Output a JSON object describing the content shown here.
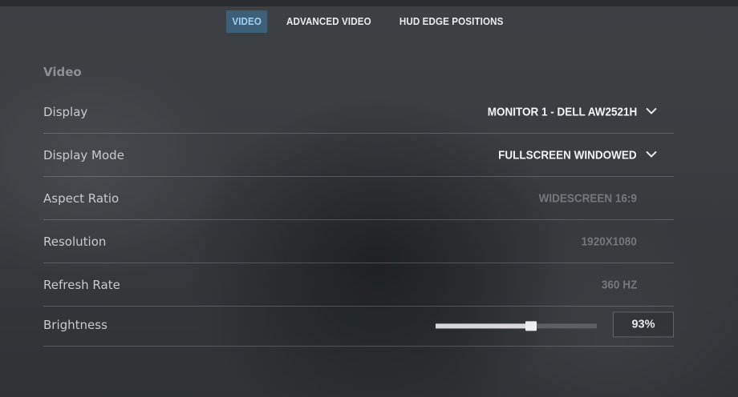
{
  "tabs": [
    {
      "label": "VIDEO",
      "active": true
    },
    {
      "label": "ADVANCED VIDEO",
      "active": false
    },
    {
      "label": "HUD EDGE POSITIONS",
      "active": false
    }
  ],
  "section": {
    "title": "Video"
  },
  "settings": {
    "display": {
      "label": "Display",
      "value": "MONITOR 1 - DELL AW2521H"
    },
    "display_mode": {
      "label": "Display Mode",
      "value": "FULLSCREEN WINDOWED"
    },
    "aspect_ratio": {
      "label": "Aspect Ratio",
      "value": "WIDESCREEN 16:9"
    },
    "resolution": {
      "label": "Resolution",
      "value": "1920X1080"
    },
    "refresh_rate": {
      "label": "Refresh Rate",
      "value": "360 HZ"
    },
    "brightness": {
      "label": "Brightness",
      "value": "93%",
      "slider_fraction": 0.59
    }
  },
  "icons": {
    "dropdown": "chevron-down-icon"
  },
  "colors": {
    "accent_tab_bg": "#3e5f78",
    "accent_tab_text": "#9fd1f2"
  }
}
